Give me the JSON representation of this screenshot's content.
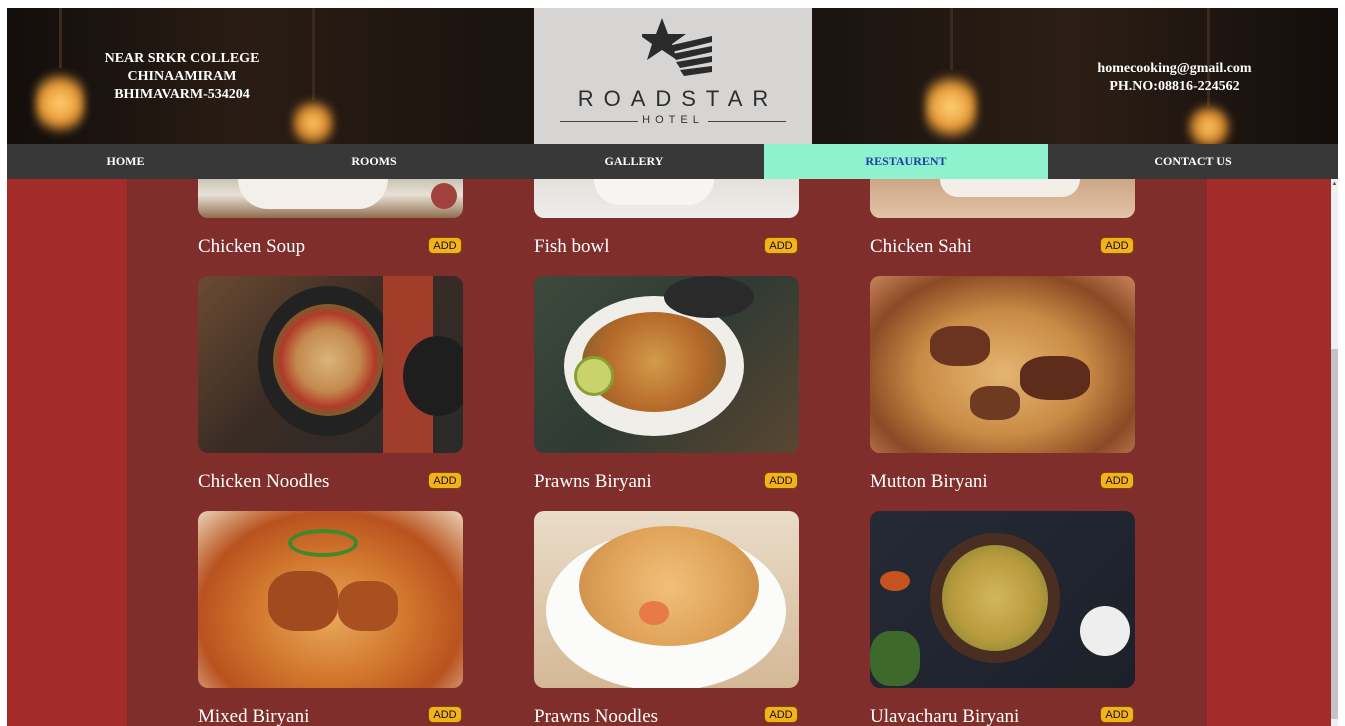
{
  "header": {
    "address_lines": [
      "NEAR SRKR COLLEGE",
      "CHINAAMIRAM",
      "BHIMAVARM-534204"
    ],
    "email": "homecooking@gmail.com",
    "phone": "PH.NO:08816-224562",
    "logo_brand": "ROADSTAR",
    "logo_sub": "HOTEL"
  },
  "nav": {
    "items": [
      "HOME",
      "ROOMS",
      "GALLERY",
      "RESTAURENT",
      "CONTACT US"
    ],
    "active": "RESTAURENT"
  },
  "menu": {
    "add_label": "ADD",
    "items": [
      {
        "name": "Chicken Soup",
        "image": "chicken-soup-photo"
      },
      {
        "name": "Fish bowl",
        "image": "fish-bowl-photo"
      },
      {
        "name": "Chicken Sahi",
        "image": "chicken-sahi-photo"
      },
      {
        "name": "Chicken Noodles",
        "image": "chicken-noodles-photo"
      },
      {
        "name": "Prawns Biryani",
        "image": "prawns-biryani-photo"
      },
      {
        "name": "Mutton Biryani",
        "image": "mutton-biryani-photo"
      },
      {
        "name": "Mixed Biryani",
        "image": "mixed-biryani-photo"
      },
      {
        "name": "Prawns Noodles",
        "image": "prawns-noodles-photo"
      },
      {
        "name": "Ulavacharu Biryani",
        "image": "ulavacharu-biryani-photo"
      }
    ]
  },
  "colors": {
    "background": "#a32b2a",
    "panel": "#7f2e2b",
    "nav": "#383838",
    "nav_active": "#8ff2cf",
    "nav_active_text": "#1f3ea8",
    "add_button": "#f5b11b"
  }
}
